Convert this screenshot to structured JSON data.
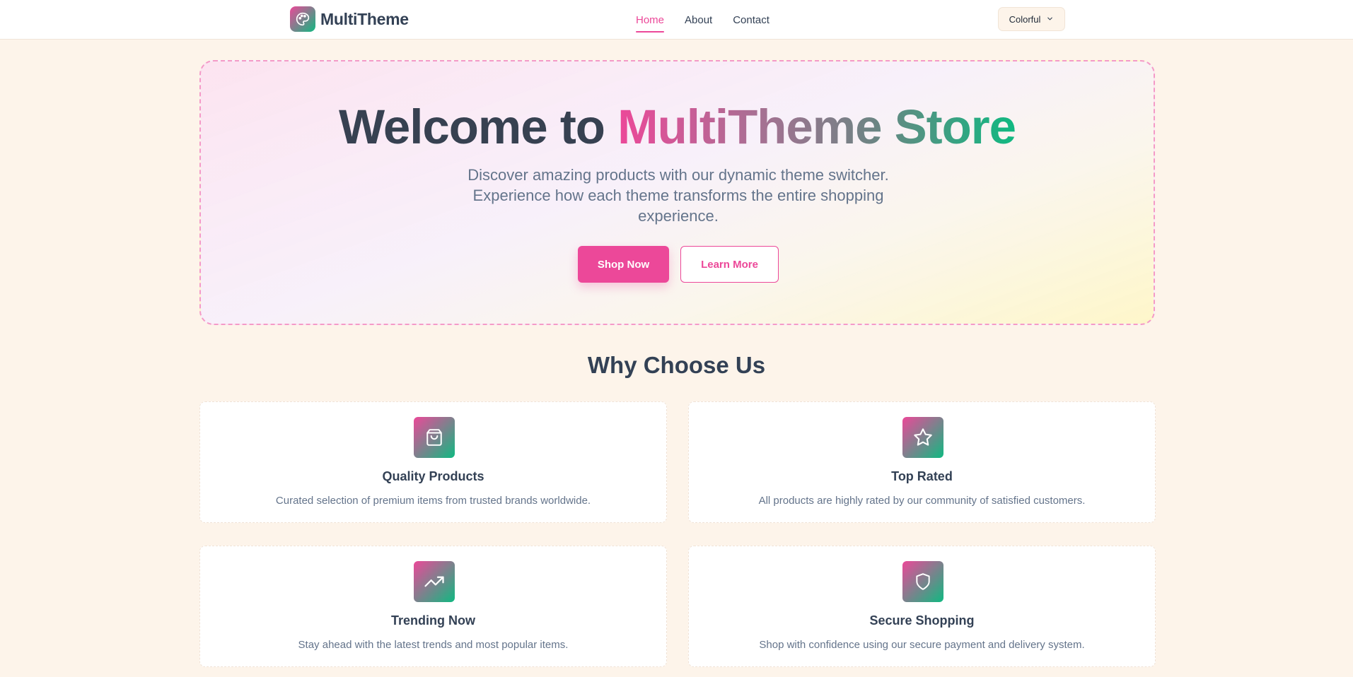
{
  "header": {
    "brand_name": "MultiTheme",
    "brand_icon": "palette-icon",
    "nav": [
      {
        "label": "Home",
        "active": true
      },
      {
        "label": "About",
        "active": false
      },
      {
        "label": "Contact",
        "active": false
      }
    ],
    "theme_selector": {
      "value": "Colorful",
      "icon": "chevron-down-icon"
    }
  },
  "hero": {
    "title_plain": "Welcome to ",
    "title_gradient": "MultiTheme Store",
    "subtitle": "Discover amazing products with our dynamic theme switcher. Experience how each theme transforms the entire shopping experience.",
    "primary_button": "Shop Now",
    "secondary_button": "Learn More"
  },
  "features": {
    "title": "Why Choose Us",
    "items": [
      {
        "icon": "shopping-bag-icon",
        "title": "Quality Products",
        "description": "Curated selection of premium items from trusted brands worldwide."
      },
      {
        "icon": "star-icon",
        "title": "Top Rated",
        "description": "All products are highly rated by our community of satisfied customers."
      },
      {
        "icon": "trending-up-icon",
        "title": "Trending Now",
        "description": "Stay ahead with the latest trends and most popular items."
      },
      {
        "icon": "shield-icon",
        "title": "Secure Shopping",
        "description": "Shop with confidence using our secure payment and delivery system."
      }
    ]
  },
  "colors": {
    "accent": "#ec4899",
    "secondary": "#10b981",
    "background": "#fdf4ea",
    "text": "#334155",
    "muted": "#64748b"
  }
}
